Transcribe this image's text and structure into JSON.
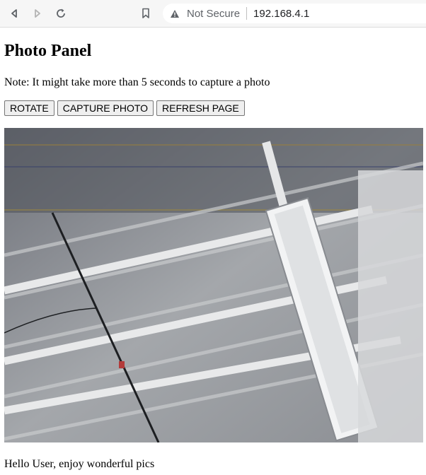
{
  "browser": {
    "security_label": "Not Secure",
    "url": "192.168.4.1",
    "icons": [
      "back-icon",
      "forward-icon",
      "reload-icon",
      "bookmark-icon",
      "warning-icon"
    ]
  },
  "page": {
    "title": "Photo Panel",
    "note": "Note: It might take more than 5 seconds to capture a photo",
    "buttons": {
      "rotate": "ROTATE",
      "capture": "CAPTURE PHOTO",
      "refresh": "REFRESH PAGE"
    },
    "footer": "Hello User, enjoy wonderful pics"
  }
}
